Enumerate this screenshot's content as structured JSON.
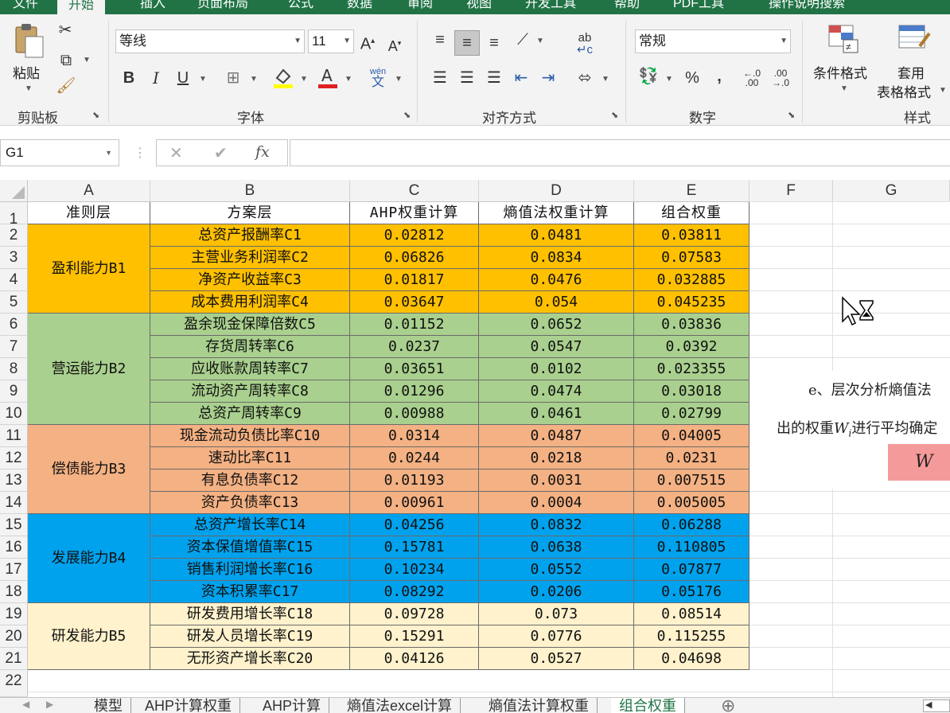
{
  "ribbon_tabs": [
    "文件",
    "开始",
    "插入",
    "页面布局",
    "公式",
    "数据",
    "审阅",
    "视图",
    "开发工具",
    "帮助",
    "PDF工具",
    "操作说明搜索"
  ],
  "active_tab_index": 1,
  "ribbon": {
    "clipboard": {
      "paste_label": "粘贴",
      "group_label": "剪贴板"
    },
    "font": {
      "font_name": "等线",
      "font_size": "11",
      "group_label": "字体",
      "phonetic_label": "wén\n文",
      "font_color": "#e02020",
      "fill_color": "#ffff00"
    },
    "alignment": {
      "group_label": "对齐方式",
      "wrap_label": "ab"
    },
    "number": {
      "format": "常规",
      "group_label": "数字",
      "percent": "%",
      "comma": ",",
      "inc_dec": ".00\n.0",
      "dec_dec": "←.0\n.00"
    },
    "styles": {
      "cond_format_label": "条件格式",
      "table_format_label_1": "套用",
      "table_format_label_2": "表格格式",
      "group_label": "样式"
    }
  },
  "formula_bar": {
    "name_box": "G1",
    "cancel": "✕",
    "enter": "✔",
    "fx": "fx",
    "formula": ""
  },
  "columns": [
    "A",
    "B",
    "C",
    "D",
    "E",
    "F",
    "G"
  ],
  "rows": [
    "1",
    "2",
    "3",
    "4",
    "5",
    "6",
    "7",
    "8",
    "9",
    "10",
    "11",
    "12",
    "13",
    "14",
    "15",
    "16",
    "17",
    "18",
    "19",
    "20",
    "21",
    "22"
  ],
  "table": {
    "headers": [
      "准则层",
      "方案层",
      "AHP权重计算",
      "熵值法权重计算",
      "组合权重"
    ],
    "groups": [
      {
        "name": "盈利能力B1",
        "color": "#ffc000",
        "rows": [
          [
            "总资产报酬率C1",
            "0.02812",
            "0.0481",
            "0.03811"
          ],
          [
            "主营业务利润率C2",
            "0.06826",
            "0.0834",
            "0.07583"
          ],
          [
            "净资产收益率C3",
            "0.01817",
            "0.0476",
            "0.032885"
          ],
          [
            "成本费用利润率C4",
            "0.03647",
            "0.054",
            "0.045235"
          ]
        ]
      },
      {
        "name": "营运能力B2",
        "color": "#a9d08e",
        "rows": [
          [
            "盈余现金保障倍数C5",
            "0.01152",
            "0.0652",
            "0.03836"
          ],
          [
            "存货周转率C6",
            "0.0237",
            "0.0547",
            "0.0392"
          ],
          [
            "应收账款周转率C7",
            "0.03651",
            "0.0102",
            "0.023355"
          ],
          [
            "流动资产周转率C8",
            "0.01296",
            "0.0474",
            "0.03018"
          ],
          [
            "总资产周转率C9",
            "0.00988",
            "0.0461",
            "0.02799"
          ]
        ]
      },
      {
        "name": "偿债能力B3",
        "color": "#f4b183",
        "rows": [
          [
            "现金流动负债比率C10",
            "0.0314",
            "0.0487",
            "0.04005"
          ],
          [
            "速动比率C11",
            "0.0244",
            "0.0218",
            "0.0231"
          ],
          [
            "有息负债率C12",
            "0.01193",
            "0.0031",
            "0.007515"
          ],
          [
            "资产负债率C13",
            "0.00961",
            "0.0004",
            "0.005005"
          ]
        ]
      },
      {
        "name": "发展能力B4",
        "color": "#00a2ed",
        "rows": [
          [
            "总资产增长率C14",
            "0.04256",
            "0.0832",
            "0.06288"
          ],
          [
            "资本保值增值率C15",
            "0.15781",
            "0.0638",
            "0.110805"
          ],
          [
            "销售利润增长率C16",
            "0.10234",
            "0.0552",
            "0.07877"
          ],
          [
            "资本积累率C17",
            "0.08292",
            "0.0206",
            "0.05176"
          ]
        ]
      },
      {
        "name": "研发能力B5",
        "color": "#fff2cc",
        "rows": [
          [
            "研发费用增长率C18",
            "0.09728",
            "0.073",
            "0.08514"
          ],
          [
            "研发人员增长率C19",
            "0.15291",
            "0.0776",
            "0.115255"
          ],
          [
            "无形资产增长率C20",
            "0.04126",
            "0.0527",
            "0.04698"
          ]
        ]
      }
    ]
  },
  "picture": {
    "line1": "e、层次分析熵值法",
    "line2_pre": "出的权重",
    "line2_var": "W",
    "line2_sub": "i",
    "line2_post": "进行平均确定",
    "formula": "W ="
  },
  "sheet_tabs": [
    "模型",
    "AHP计算权重",
    "AHP计算",
    "熵值法excel计算",
    "熵值法计算权重",
    "组合权重"
  ],
  "active_sheet_index": 5,
  "add_sheet": "⊕"
}
